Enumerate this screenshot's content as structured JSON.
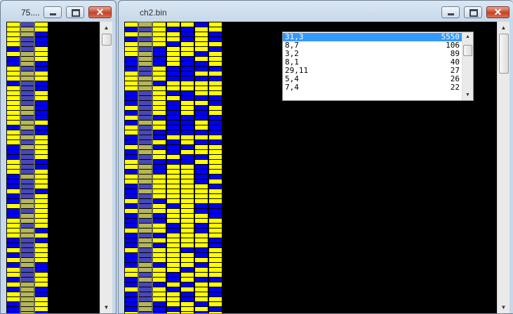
{
  "windows": [
    {
      "title": "75...."
    },
    {
      "title": "ch2.bin"
    }
  ],
  "controls": {
    "minimize": "minimize",
    "maximize": "maximize",
    "close": "close"
  },
  "colors": {
    "yellow": "#ffff00",
    "blue": "#0000ee",
    "highlight_column": "#8a8a5a",
    "black": "#000000"
  },
  "listbox": {
    "items": [
      {
        "key": "31,3",
        "value": "5550",
        "selected": true
      },
      {
        "key": "8,7",
        "value": "106"
      },
      {
        "key": "3,2",
        "value": "89"
      },
      {
        "key": "8,1",
        "value": "40"
      },
      {
        "key": "29,11",
        "value": "27"
      },
      {
        "key": "5,4",
        "value": "26"
      },
      {
        "key": "7,4",
        "value": "22"
      }
    ]
  }
}
